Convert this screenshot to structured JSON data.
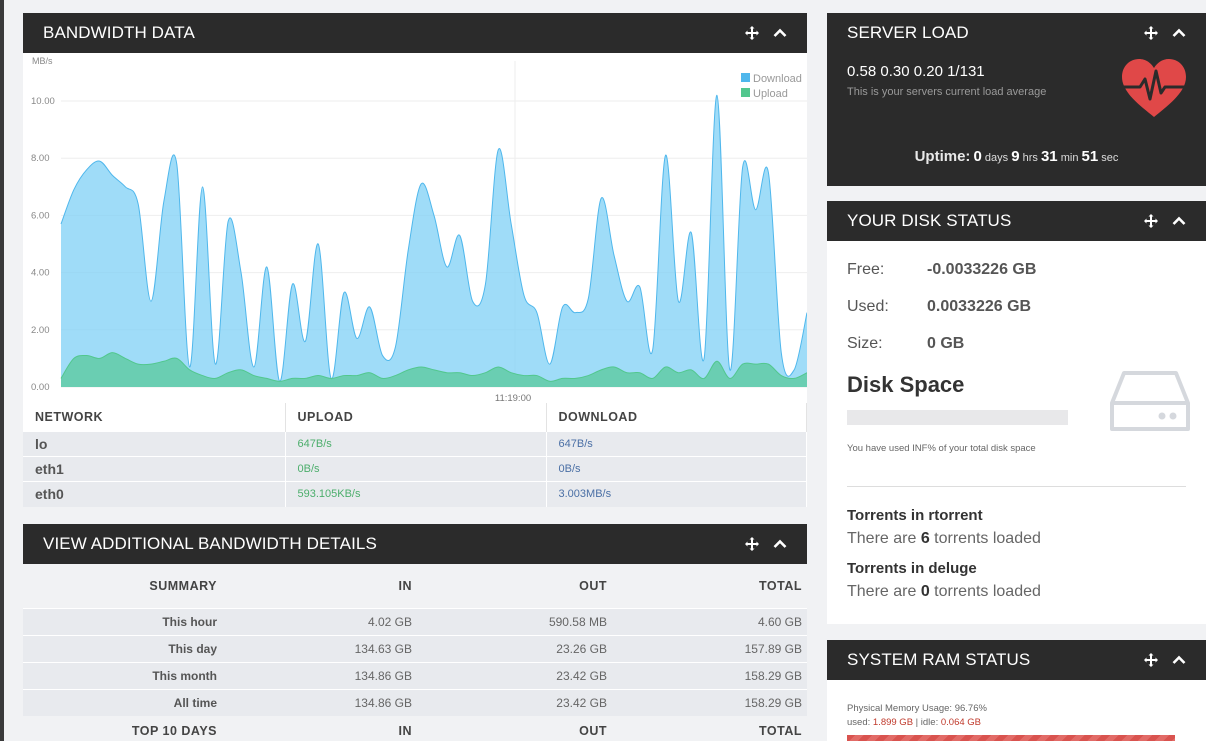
{
  "bandwidth": {
    "title": "BANDWIDTH DATA",
    "chart_data": {
      "type": "area",
      "ylabel": "MB/s",
      "yticks": [
        "0.00",
        "2.00",
        "4.00",
        "6.00",
        "8.00",
        "10.00"
      ],
      "ylim": [
        0,
        11.4
      ],
      "xtick": "11:19:00",
      "grid": true,
      "legend_position": "top-right",
      "series": [
        {
          "name": "Download",
          "color": "#7fd0f5",
          "values": [
            5.7,
            6.9,
            7.6,
            7.9,
            7.4,
            7.0,
            6.4,
            3.0,
            6.5,
            7.8,
            0.7,
            7.0,
            0.8,
            5.8,
            4.0,
            0.7,
            4.2,
            0.2,
            3.6,
            1.6,
            5.0,
            0.3,
            3.3,
            1.7,
            2.8,
            1.1,
            1.4,
            4.8,
            7.1,
            6.0,
            4.2,
            5.3,
            3.0,
            3.6,
            8.3,
            5.7,
            3.2,
            2.6,
            0.8,
            2.8,
            2.6,
            3.1,
            6.6,
            4.6,
            3.0,
            3.5,
            1.3,
            8.1,
            3.0,
            5.4,
            1.0,
            10.2,
            0.6,
            7.7,
            6.2,
            7.5,
            1.2,
            0.6,
            2.6
          ]
        },
        {
          "name": "Upload",
          "color": "#5ccaa0",
          "values": [
            0.3,
            1.0,
            1.1,
            1.0,
            1.2,
            1.0,
            0.8,
            0.8,
            0.9,
            1.0,
            0.6,
            0.4,
            0.3,
            0.5,
            0.6,
            0.4,
            0.3,
            0.2,
            0.3,
            0.3,
            0.4,
            0.3,
            0.4,
            0.4,
            0.5,
            0.3,
            0.4,
            0.6,
            0.7,
            0.6,
            0.5,
            0.5,
            0.4,
            0.5,
            0.7,
            0.5,
            0.4,
            0.4,
            0.2,
            0.3,
            0.3,
            0.4,
            0.6,
            0.7,
            0.5,
            0.5,
            0.3,
            0.7,
            0.5,
            0.6,
            0.3,
            0.9,
            0.3,
            0.8,
            0.8,
            0.8,
            0.4,
            0.3,
            0.5
          ]
        }
      ]
    },
    "table": {
      "headers": [
        "NETWORK",
        "UPLOAD",
        "DOWNLOAD"
      ],
      "rows": [
        {
          "iface": "lo",
          "up": "647B/s",
          "down": "647B/s"
        },
        {
          "iface": "eth1",
          "up": "0B/s",
          "down": "0B/s"
        },
        {
          "iface": "eth0",
          "up": "593.105KB/s",
          "down": "3.003MB/s"
        }
      ]
    }
  },
  "additional": {
    "title": "VIEW ADDITIONAL BANDWIDTH DETAILS",
    "headers": [
      "SUMMARY",
      "IN",
      "OUT",
      "TOTAL"
    ],
    "rows": [
      [
        "This hour",
        "4.02 GB",
        "590.58 MB",
        "4.60 GB"
      ],
      [
        "This day",
        "134.63 GB",
        "23.26 GB",
        "157.89 GB"
      ],
      [
        "This month",
        "134.86 GB",
        "23.42 GB",
        "158.29 GB"
      ],
      [
        "All time",
        "134.86 GB",
        "23.42 GB",
        "158.29 GB"
      ]
    ],
    "next_headers": [
      "TOP 10 DAYS",
      "IN",
      "OUT",
      "TOTAL"
    ]
  },
  "server_load": {
    "title": "SERVER LOAD",
    "value": "0.58 0.30 0.20 1/131",
    "subtitle": "This is your servers current load average",
    "uptime_label": "Uptime:",
    "days": "0",
    "days_unit": "days",
    "hrs": "9",
    "hrs_unit": "hrs",
    "min": "31",
    "min_unit": "min",
    "sec": "51",
    "sec_unit": "sec"
  },
  "disk": {
    "title": "YOUR DISK STATUS",
    "free_label": "Free:",
    "free": "-0.0033226 GB",
    "used_label": "Used:",
    "used": "0.0033226 GB",
    "size_label": "Size:",
    "size": "0 GB",
    "space_title": "Disk Space",
    "usage_note": "You have used INF% of your total disk space",
    "rtorrent_title": "Torrents in rtorrent",
    "rtorrent_pre": "There are ",
    "rtorrent_count": "6",
    "rtorrent_post": " torrents loaded",
    "deluge_title": "Torrents in deluge",
    "deluge_pre": "There are ",
    "deluge_count": "0",
    "deluge_post": " torrents loaded"
  },
  "ram": {
    "title": "SYSTEM RAM STATUS",
    "usage": "Physical Memory Usage: 96.76%",
    "used_label": "used: ",
    "used": "1.899 GB",
    "idle_label": " | idle: ",
    "idle": "0.064 GB",
    "usage_fraction": 0.9676
  }
}
